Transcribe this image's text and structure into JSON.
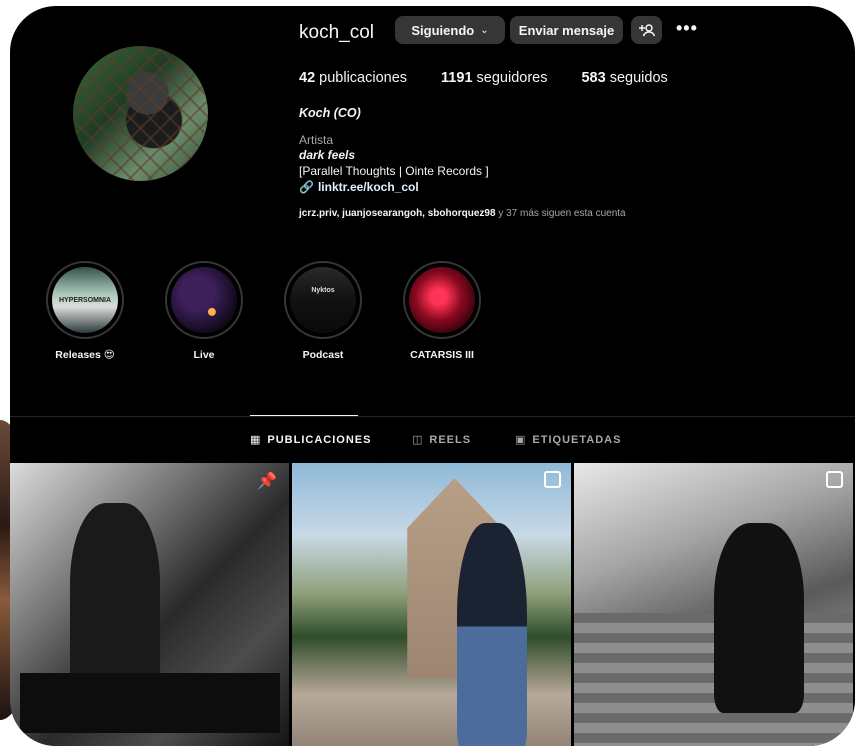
{
  "profile": {
    "username": "koch_col",
    "following_label": "Siguiendo",
    "message_label": "Enviar mensaje",
    "add_user_icon": "+И",
    "more_icon": "•••",
    "stats": {
      "posts_count": "42",
      "posts_label": "publicaciones",
      "followers_count": "1191",
      "followers_label": "seguidores",
      "following_count": "583",
      "following_label": "seguidos"
    },
    "full_name": "Koch (CO)",
    "category": "Artista",
    "bio_line1": "dark feels",
    "bio_line2": "[Parallel Thoughts | Ointe Records ]",
    "link": "linktr.ee/koch_col",
    "followed_by_names": "jcrz.priv, juanjosearangoh, sbohorquez98",
    "followed_by_rest": "y 37 más siguen esta cuenta"
  },
  "highlights": [
    {
      "label": "Releases 😍",
      "tag": "HYPERSOMNIA"
    },
    {
      "label": "Live",
      "tag": ""
    },
    {
      "label": "Podcast",
      "tag": "Nyktos"
    },
    {
      "label": "CATARSIS III",
      "tag": ""
    }
  ],
  "tabs": [
    {
      "label": "PUBLICACIONES",
      "icon": "grid-icon",
      "active": true
    },
    {
      "label": "REELS",
      "icon": "reels-icon",
      "active": false
    },
    {
      "label": "ETIQUETADAS",
      "icon": "tagged-icon",
      "active": false
    }
  ],
  "colors": {
    "background": "#000000",
    "button": "#363636",
    "text": "#f5f5f5",
    "muted": "#a8a8a8",
    "link": "#e0f1ff"
  }
}
